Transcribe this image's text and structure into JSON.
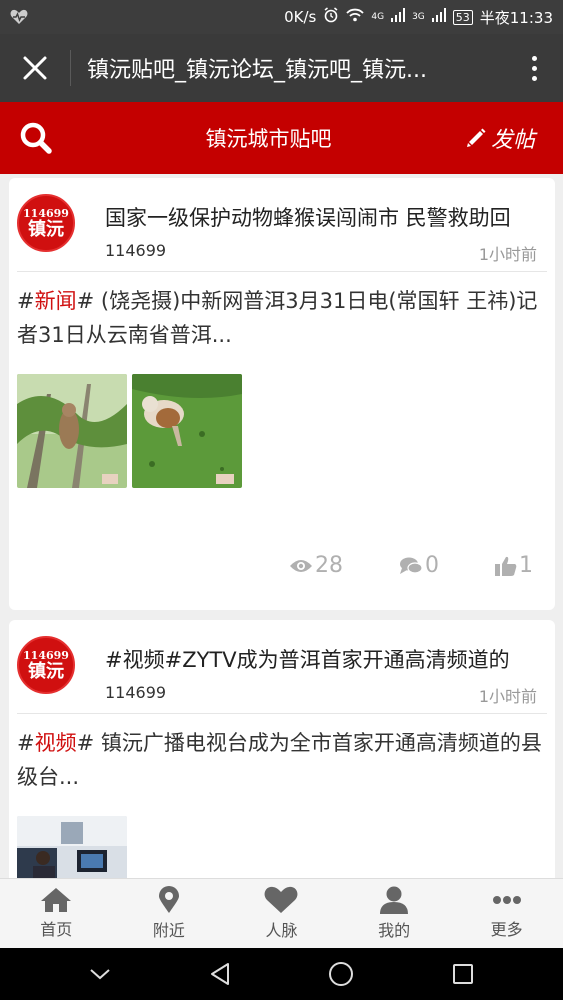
{
  "status_bar": {
    "speed": "0K/s",
    "network_1": "4G",
    "network_2": "3G",
    "battery": "53",
    "time": "半夜11:33"
  },
  "title_bar": {
    "title": "镇沅贴吧_镇沅论坛_镇沅吧_镇沅..."
  },
  "header": {
    "title": "镇沅城市贴吧",
    "post_label": "发帖"
  },
  "posts": [
    {
      "avatar_num": "114699",
      "avatar_name": "镇沅",
      "title": "国家一级保护动物蜂猴误闯闹市 民警救助回",
      "author": "114699",
      "time": "1小时前",
      "hashtag": "新闻",
      "excerpt": " (饶尧摄)中新网普洱3月31日电(常国轩 王祎)记者31日从云南省普洱...",
      "views": "28",
      "comments": "0",
      "likes": "1"
    },
    {
      "avatar_num": "114699",
      "avatar_name": "镇沅",
      "title": "#视频#ZYTV成为普洱首家开通高清频道的",
      "author": "114699",
      "time": "1小时前",
      "hashtag": "视频",
      "excerpt": " 镇沅广播电视台成为全市首家开通高清频道的县级台..."
    }
  ],
  "tabs": [
    {
      "label": "首页",
      "icon": "home-icon"
    },
    {
      "label": "附近",
      "icon": "location-pin-icon"
    },
    {
      "label": "人脉",
      "icon": "heart-icon"
    },
    {
      "label": "我的",
      "icon": "user-icon"
    },
    {
      "label": "更多",
      "icon": "more-dots-icon"
    }
  ],
  "colors": {
    "brand_red": "#c40000",
    "titlebar": "#3a3a3a",
    "statusbar": "#3d3d3d"
  }
}
